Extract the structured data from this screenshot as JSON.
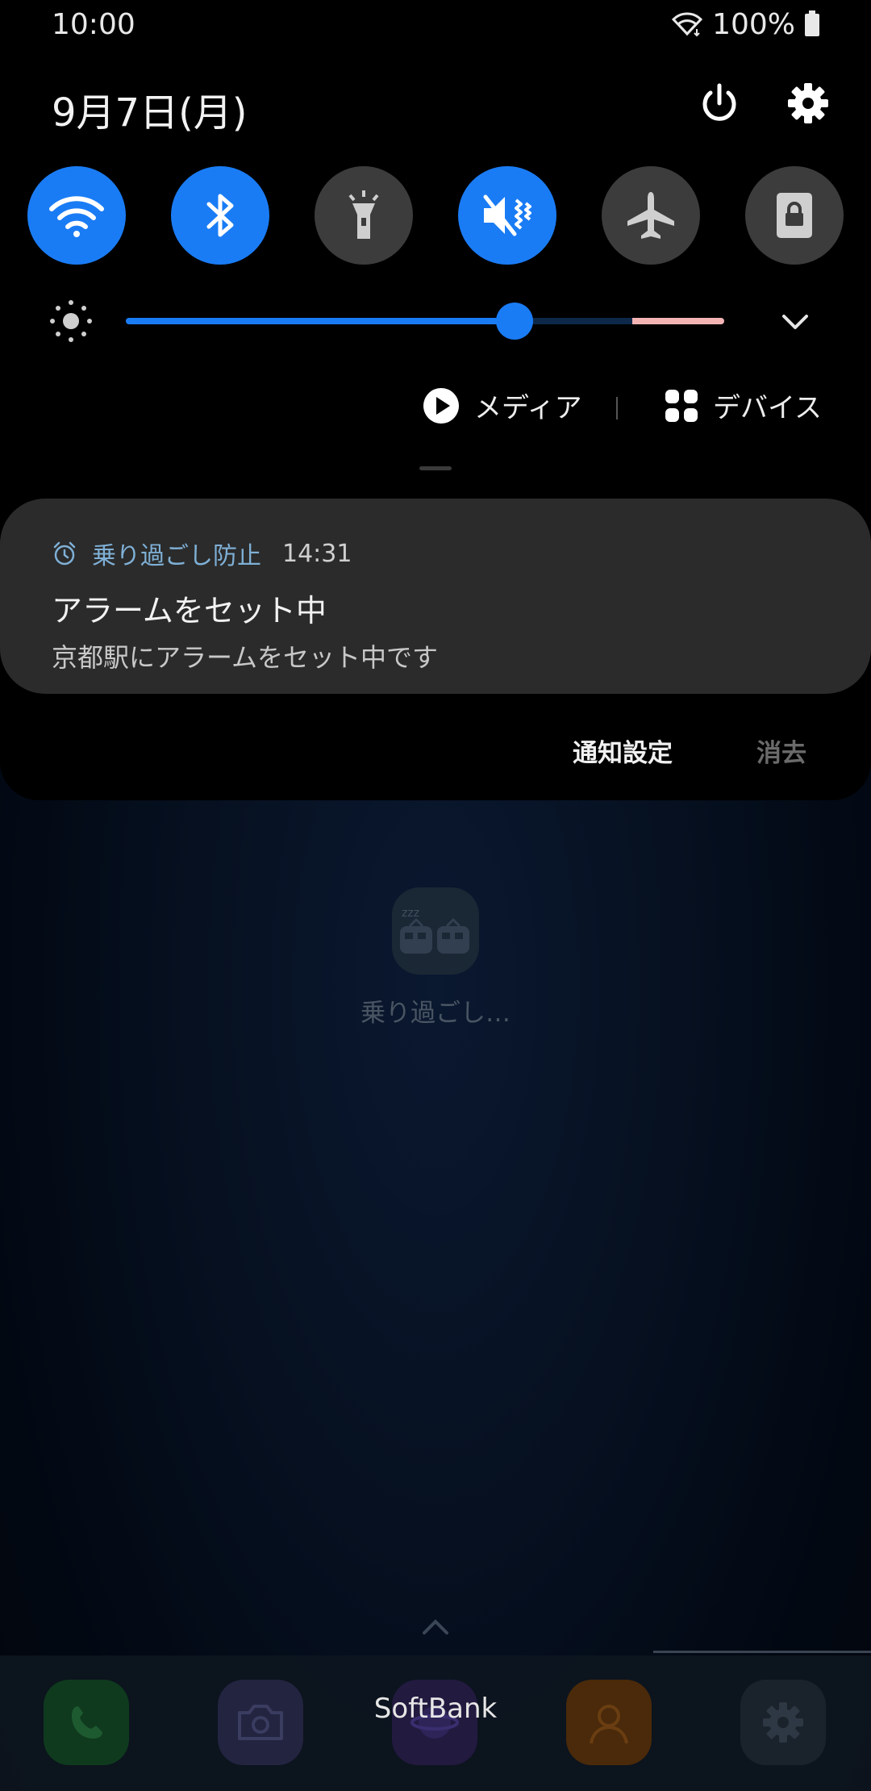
{
  "status_bar": {
    "time": "10:00",
    "battery": "100%"
  },
  "quick_panel": {
    "date": "9月7日(月)",
    "tiles": [
      {
        "name": "wifi",
        "state": "on",
        "icon": "wifi-icon"
      },
      {
        "name": "bluetooth",
        "state": "on",
        "icon": "bluetooth-icon"
      },
      {
        "name": "flashlight",
        "state": "off",
        "icon": "flashlight-icon"
      },
      {
        "name": "vibrate",
        "state": "on",
        "icon": "vibrate-icon"
      },
      {
        "name": "airplane",
        "state": "off",
        "icon": "airplane-icon"
      },
      {
        "name": "lock-rotation",
        "state": "off",
        "icon": "lock-icon"
      }
    ],
    "brightness": {
      "level": 0.65,
      "warning_zone_start": 0.85
    },
    "media_label": "メディア",
    "device_label": "デバイス"
  },
  "notification": {
    "app_name": "乗り過ごし防止",
    "time": "14:31",
    "title": "アラームをセット中",
    "body": "京都駅にアラームをセット中です"
  },
  "notification_actions": {
    "settings": "通知設定",
    "clear": "消去"
  },
  "home": {
    "app_label": "乗り過ごし…",
    "carrier": "SoftBank",
    "dock": [
      "phone-icon",
      "camera-icon",
      "browser-icon",
      "contacts-icon",
      "settings-icon"
    ]
  },
  "colors": {
    "accent": "#1a7cf5",
    "tile_off": "#3c3c3c",
    "card": "#2b2b2b"
  }
}
